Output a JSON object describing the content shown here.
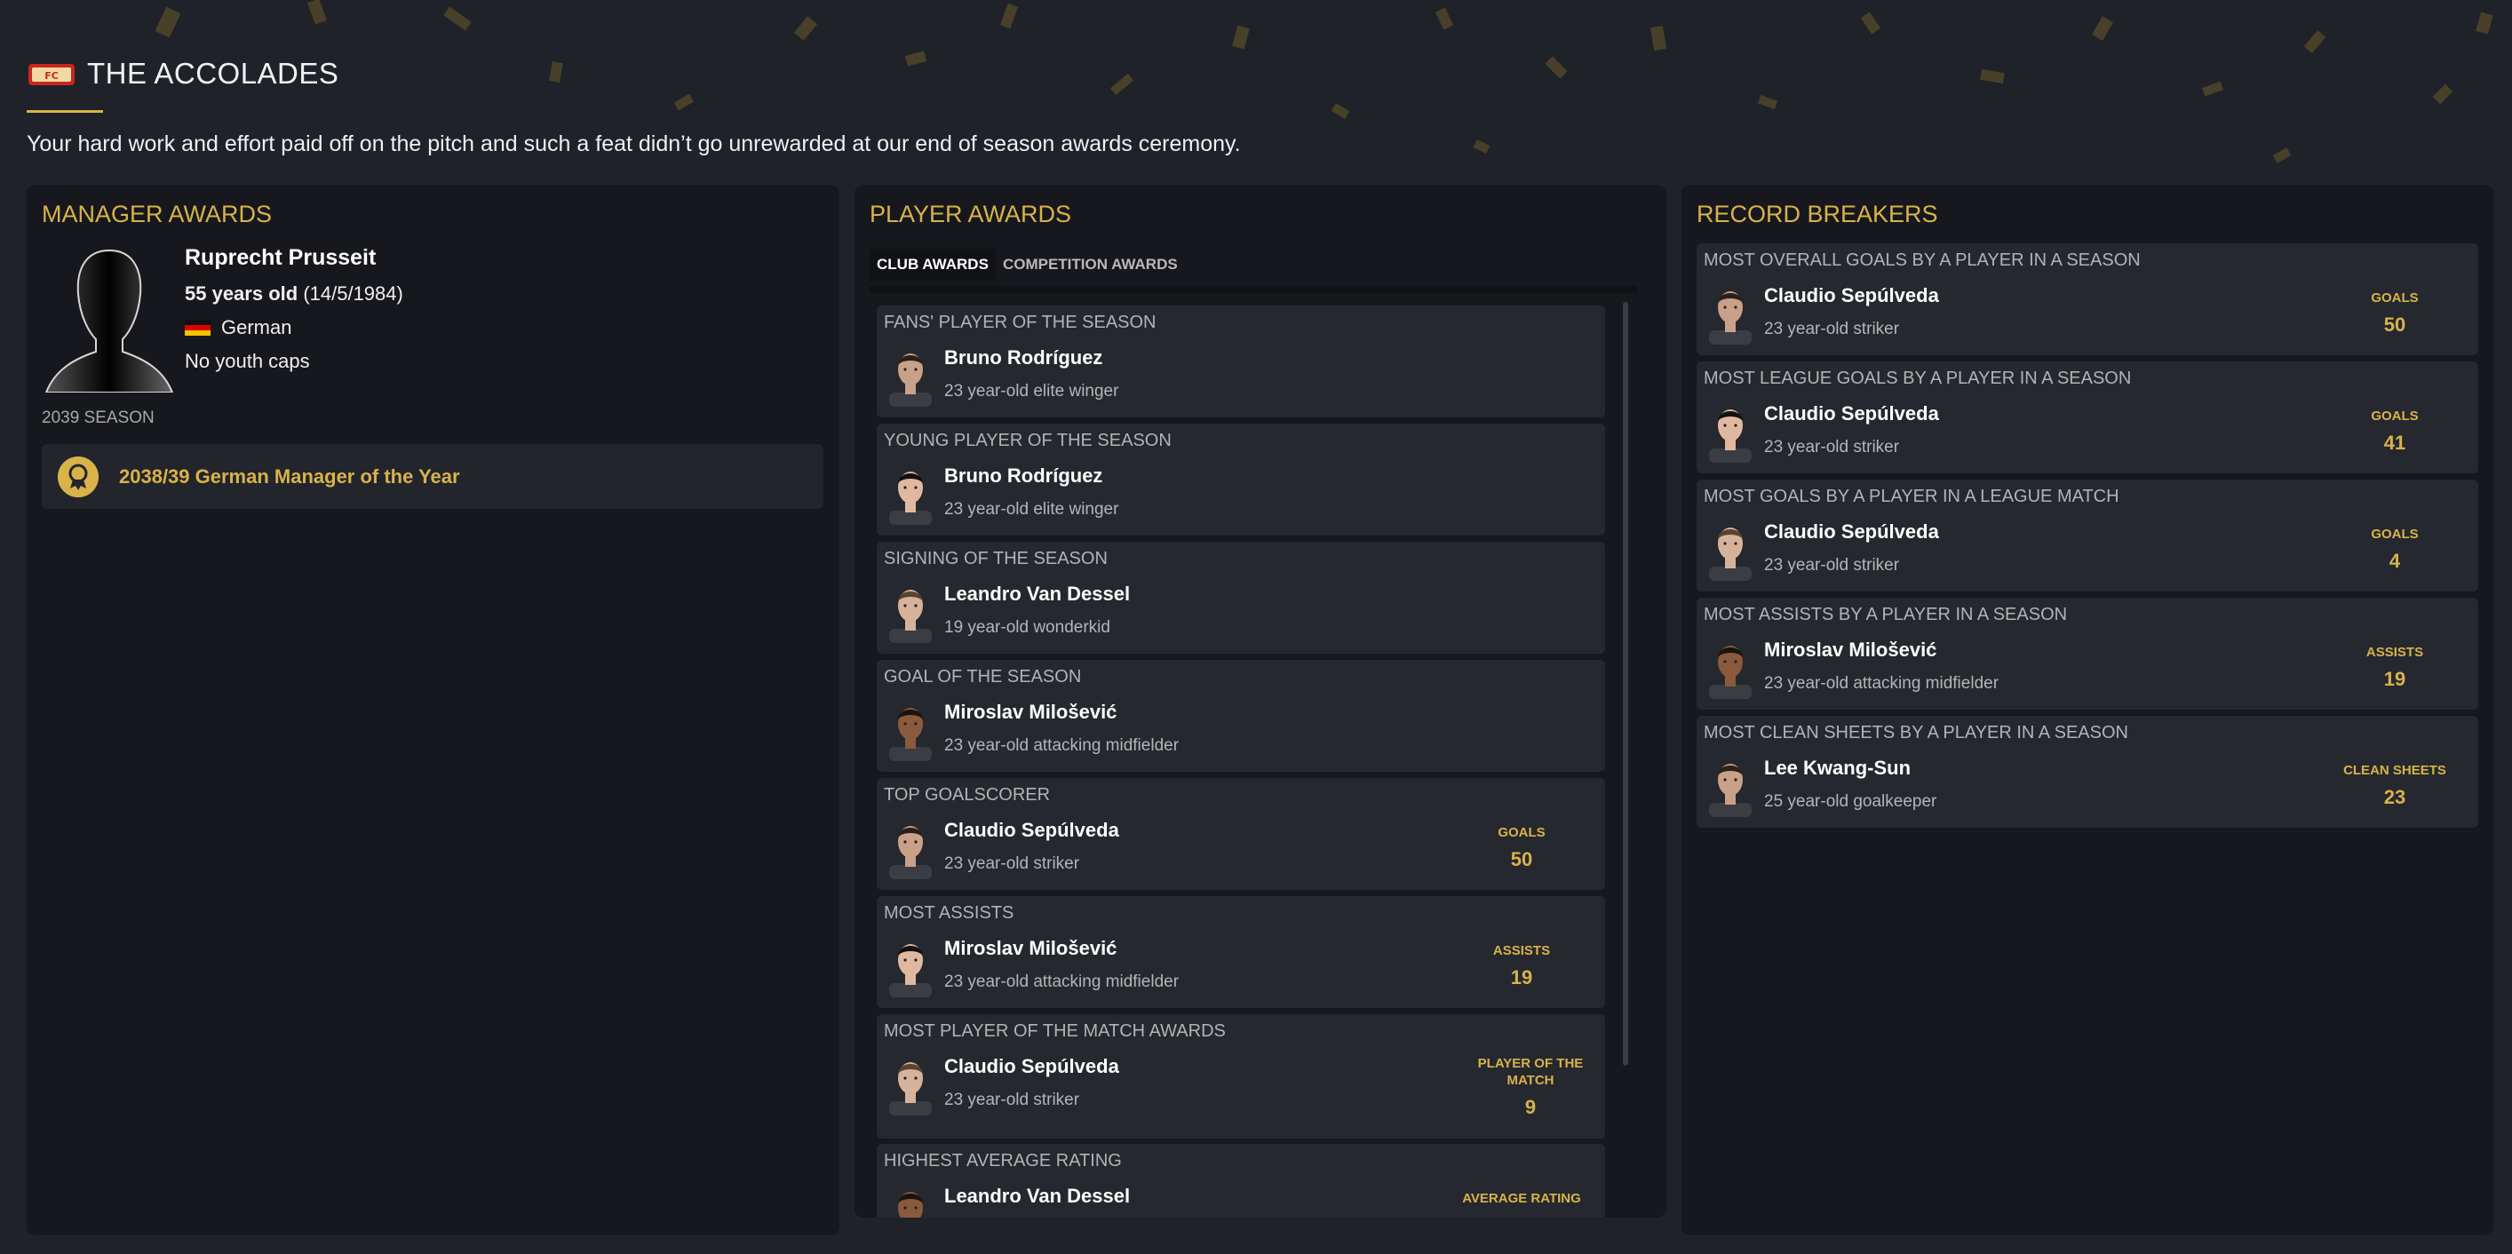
{
  "header": {
    "title": "THE ACCOLADES",
    "subtitle": "Your hard work and effort paid off on the pitch and such a feat didn’t go unrewarded at our end of season awards ceremony.",
    "logo_icon": "club-crest-icon"
  },
  "colors": {
    "accent": "#d9b24a",
    "panel": "#16181d",
    "card": "#25282e",
    "background": "#1f2229"
  },
  "manager_awards": {
    "title": "MANAGER AWARDS",
    "name": "Ruprecht Prusseit",
    "age": "55 years old",
    "dob": "(14/5/1984)",
    "nationality": "German",
    "youth_caps": "No youth caps",
    "season_label": "2039 SEASON",
    "award": "2038/39 German Manager of the Year"
  },
  "player_awards": {
    "title": "PLAYER AWARDS",
    "tabs": [
      {
        "label": "CLUB AWARDS",
        "active": true
      },
      {
        "label": "COMPETITION AWARDS",
        "active": false
      }
    ],
    "awards": [
      {
        "heading": "FANS' PLAYER OF THE SEASON",
        "name": "Bruno Rodríguez",
        "desc": "23 year-old elite winger"
      },
      {
        "heading": "YOUNG PLAYER OF THE SEASON",
        "name": "Bruno Rodríguez",
        "desc": "23 year-old elite winger"
      },
      {
        "heading": "SIGNING OF THE SEASON",
        "name": "Leandro Van Dessel",
        "desc": "19 year-old wonderkid"
      },
      {
        "heading": "GOAL OF THE SEASON",
        "name": "Miroslav Milošević",
        "desc": "23 year-old attacking midfielder"
      },
      {
        "heading": "TOP GOALSCORER",
        "name": "Claudio Sepúlveda",
        "desc": "23 year-old striker",
        "stat_label": "GOALS",
        "stat_value": "50"
      },
      {
        "heading": "MOST ASSISTS",
        "name": "Miroslav Milošević",
        "desc": "23 year-old attacking midfielder",
        "stat_label": "ASSISTS",
        "stat_value": "19"
      },
      {
        "heading": "MOST PLAYER OF THE MATCH AWARDS",
        "name": "Claudio Sepúlveda",
        "desc": "23 year-old striker",
        "stat_label": "PLAYER OF THE MATCH",
        "stat_value": "9"
      },
      {
        "heading": "HIGHEST AVERAGE RATING",
        "name": "Leandro Van Dessel",
        "desc": "",
        "stat_label": "AVERAGE RATING",
        "stat_value": ""
      }
    ]
  },
  "record_breakers": {
    "title": "RECORD BREAKERS",
    "records": [
      {
        "heading": "MOST OVERALL GOALS BY A PLAYER IN A SEASON",
        "name": "Claudio Sepúlveda",
        "desc": "23 year-old striker",
        "stat_label": "GOALS",
        "stat_value": "50"
      },
      {
        "heading": "MOST LEAGUE GOALS BY A PLAYER IN A SEASON",
        "name": "Claudio Sepúlveda",
        "desc": "23 year-old striker",
        "stat_label": "GOALS",
        "stat_value": "41"
      },
      {
        "heading": "MOST GOALS BY A PLAYER IN A LEAGUE MATCH",
        "name": "Claudio Sepúlveda",
        "desc": "23 year-old striker",
        "stat_label": "GOALS",
        "stat_value": "4"
      },
      {
        "heading": "MOST ASSISTS BY A PLAYER IN A SEASON",
        "name": "Miroslav Milošević",
        "desc": "23 year-old attacking midfielder",
        "stat_label": "ASSISTS",
        "stat_value": "19"
      },
      {
        "heading": "MOST CLEAN SHEETS BY A PLAYER IN A SEASON",
        "name": "Lee Kwang-Sun",
        "desc": "25 year-old goalkeeper",
        "stat_label": "CLEAN SHEETS",
        "stat_value": "23"
      }
    ]
  }
}
